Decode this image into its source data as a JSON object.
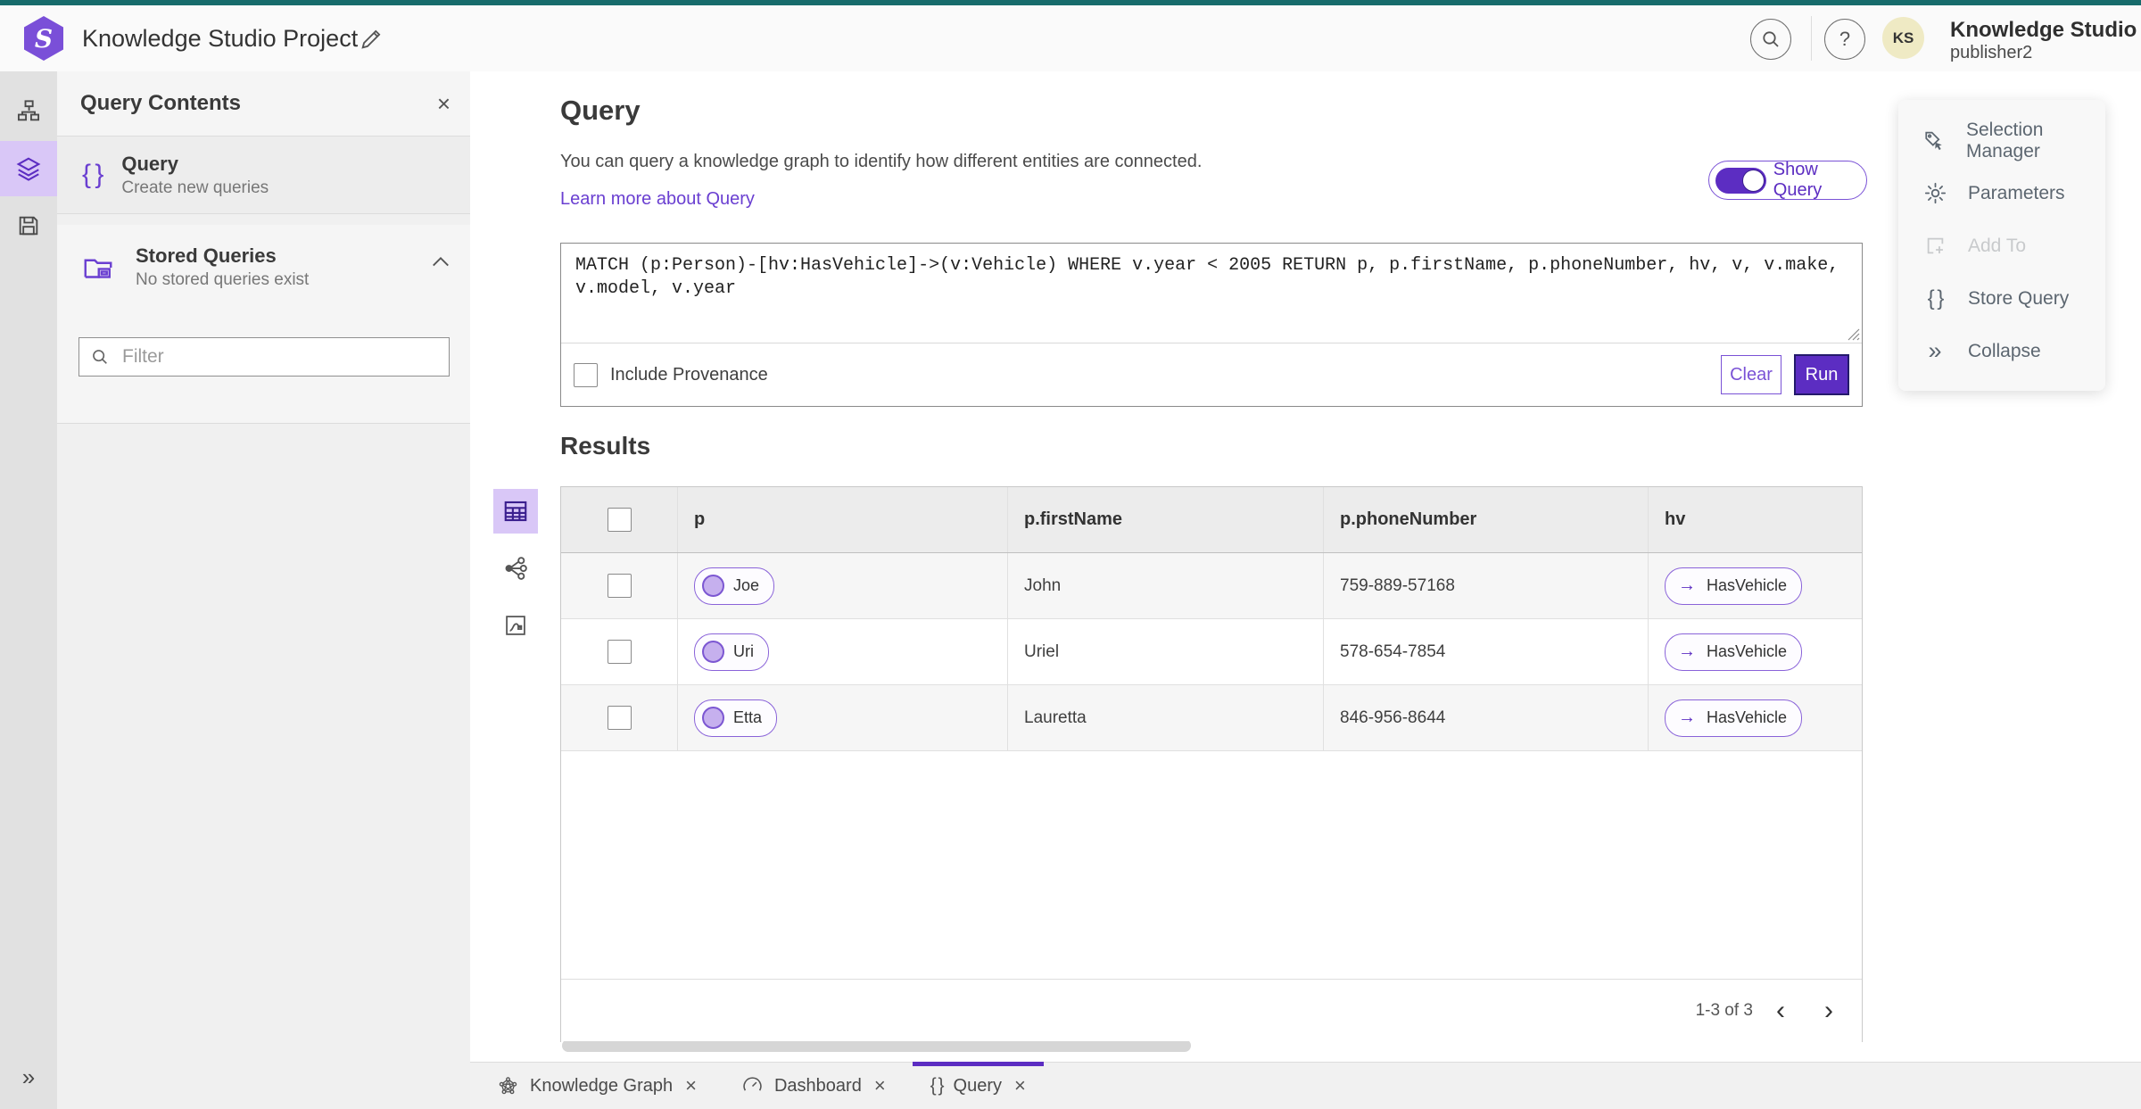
{
  "header": {
    "app_title": "Knowledge Studio Project",
    "user_title": "Knowledge Studio",
    "user_subtitle": "publisher2",
    "avatar_initials": "KS",
    "help_glyph": "?"
  },
  "rail": {
    "expand_glyph": "»"
  },
  "left_panel": {
    "title": "Query Contents",
    "close_glyph": "×",
    "query_item": {
      "icon_glyph": "{ }",
      "title": "Query",
      "subtitle": "Create new queries"
    },
    "stored": {
      "title": "Stored Queries",
      "subtitle": "No stored queries exist"
    },
    "filter_placeholder": "Filter"
  },
  "main": {
    "title": "Query",
    "description": "You can query a knowledge graph to identify how different entities are connected.",
    "learn_more": "Learn more about Query",
    "show_query_label": "Show Query",
    "query_text": "MATCH (p:Person)-[hv:HasVehicle]->(v:Vehicle) WHERE v.year < 2005 RETURN p, p.firstName, p.phoneNumber, hv, v, v.make, v.model, v.year",
    "include_provenance_label": "Include Provenance",
    "clear_label": "Clear",
    "run_label": "Run",
    "results_title": "Results"
  },
  "results": {
    "columns": [
      "p",
      "p.firstName",
      "p.phoneNumber",
      "hv"
    ],
    "rows": [
      {
        "p": "Joe",
        "firstName": "John",
        "phone": "759-889-57168",
        "hv": "HasVehicle"
      },
      {
        "p": "Uri",
        "firstName": "Uriel",
        "phone": "578-654-7854",
        "hv": "HasVehicle"
      },
      {
        "p": "Etta",
        "firstName": "Lauretta",
        "phone": "846-956-8644",
        "hv": "HasVehicle"
      }
    ],
    "arrow_glyph": "→",
    "pagination": "1-3 of 3",
    "prev_glyph": "‹",
    "next_glyph": "›"
  },
  "right_panel": {
    "braces_glyph": "{ }",
    "collapse_glyph": "»",
    "items": [
      {
        "label": "Selection Manager"
      },
      {
        "label": "Parameters"
      },
      {
        "label": "Add To"
      },
      {
        "label": "Store Query"
      },
      {
        "label": "Collapse"
      }
    ]
  },
  "tabs": {
    "close_glyph": "×",
    "items": [
      {
        "label": "Knowledge Graph"
      },
      {
        "label": "Dashboard"
      },
      {
        "label": "Query"
      }
    ]
  },
  "colors": {
    "top_accent": "#176b6b",
    "accent_purple": "#5c2dc2",
    "link_purple": "#6a3fd1",
    "lavender_active": "#d9c7f7"
  }
}
